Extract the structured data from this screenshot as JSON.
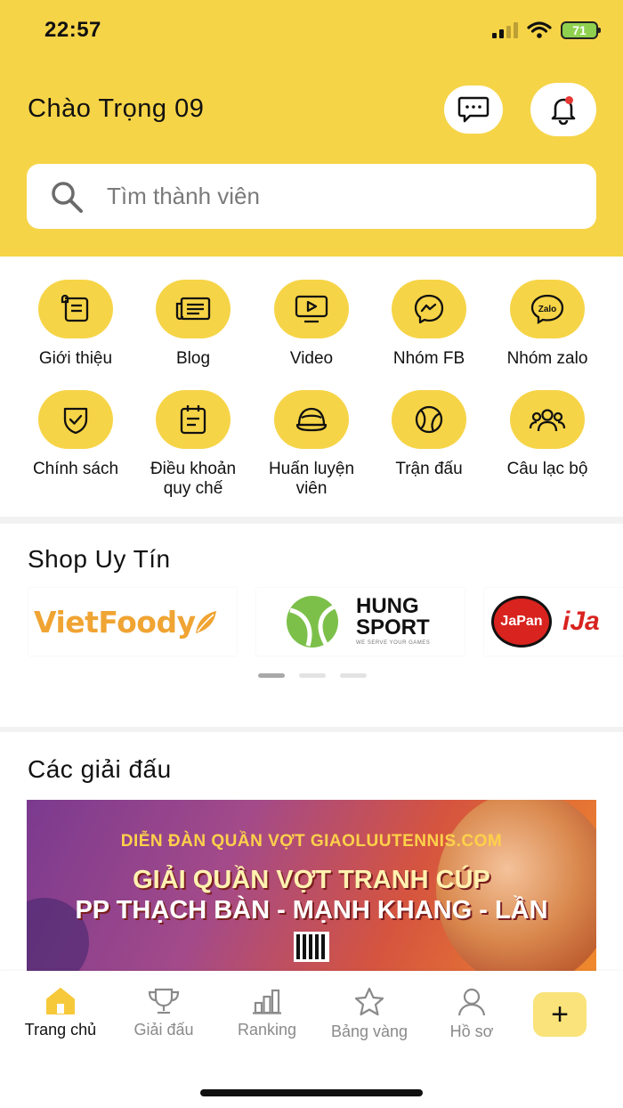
{
  "status": {
    "time": "22:57",
    "battery": "71"
  },
  "header": {
    "greeting": "Chào Trọng 09",
    "search_placeholder": "Tìm thành viên",
    "accent_color": "#f6d447"
  },
  "menu": {
    "items": [
      {
        "label": "Giới thiệu",
        "icon": "scroll-icon"
      },
      {
        "label": "Blog",
        "icon": "newspaper-icon"
      },
      {
        "label": "Video",
        "icon": "video-play-icon"
      },
      {
        "label": "Nhóm FB",
        "icon": "messenger-icon"
      },
      {
        "label": "Nhóm zalo",
        "icon": "zalo-icon"
      },
      {
        "label": "Chính sách",
        "icon": "shield-check-icon"
      },
      {
        "label": "Điều khoản quy chế",
        "icon": "calendar-list-icon"
      },
      {
        "label": "Huấn luyện viên",
        "icon": "cap-icon"
      },
      {
        "label": "Trận đấu",
        "icon": "tennis-ball-icon"
      },
      {
        "label": "Câu lạc bộ",
        "icon": "group-icon"
      }
    ]
  },
  "shop": {
    "title": "Shop Uy Tín",
    "cards": [
      {
        "name": "VietFoody"
      },
      {
        "name_line1": "HUNG",
        "name_line2": "SPORT",
        "tagline": "WE SERVE YOUR GAMES"
      },
      {
        "badge": "JaPan",
        "name": "iJa"
      }
    ],
    "page_count": 3,
    "active_page": 1
  },
  "tournaments": {
    "title": "Các giải đấu",
    "banner": {
      "top": "DIỄN ĐÀN QUẦN VỢT GIAOLUUTENNIS.COM",
      "line1": "GIẢI QUẦN VỢT TRANH CÚP",
      "line2": "PP THẠCH BÀN - MẠNH KHANG - LẦN"
    }
  },
  "bottom_nav": {
    "items": [
      {
        "label": "Trang chủ",
        "icon": "home-icon",
        "active": true
      },
      {
        "label": "Giải đấu",
        "icon": "trophy-icon",
        "active": false
      },
      {
        "label": "Ranking",
        "icon": "bar-chart-icon",
        "active": false
      },
      {
        "label": "Bảng vàng",
        "icon": "star-icon",
        "active": false
      },
      {
        "label": "Hồ sơ",
        "icon": "user-icon",
        "active": false
      }
    ],
    "plus_label": "+"
  }
}
